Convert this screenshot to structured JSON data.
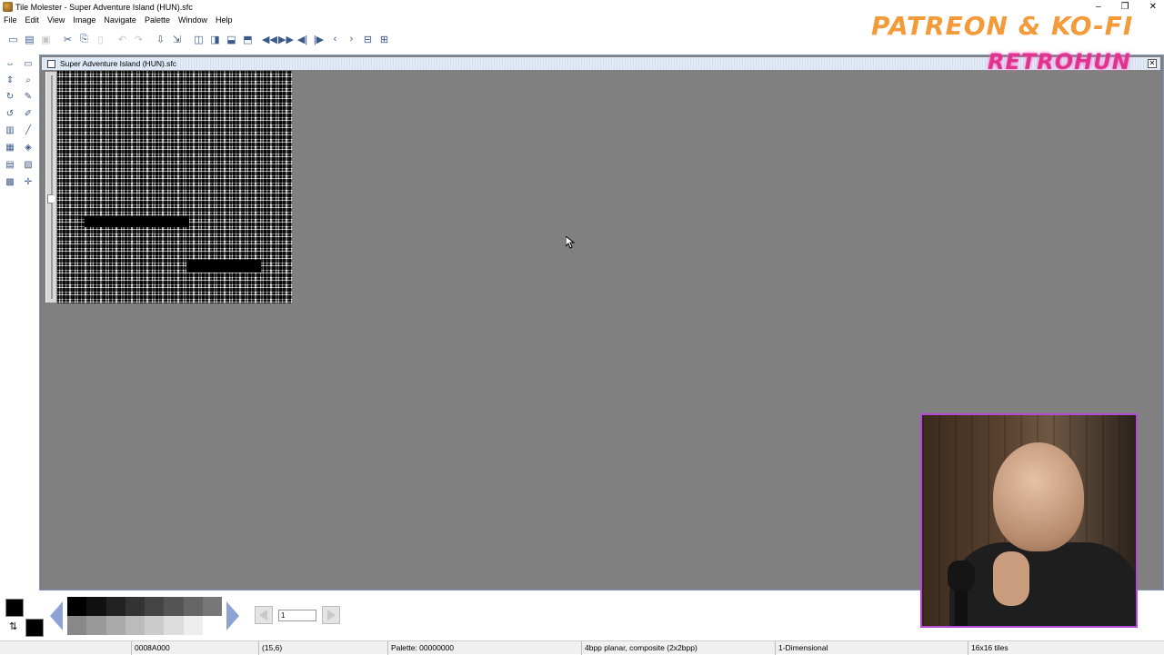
{
  "window": {
    "title": "Tile Molester - Super Adventure Island (HUN).sfc",
    "minimize": "–",
    "maximize": "❐",
    "close": "✕"
  },
  "menu": [
    "File",
    "Edit",
    "View",
    "Image",
    "Navigate",
    "Palette",
    "Window",
    "Help"
  ],
  "toolbar_icons": [
    "new-file-icon",
    "open-file-icon",
    "save-icon",
    "cut-icon",
    "copy-icon",
    "paste-icon",
    "undo-icon",
    "redo-icon",
    "go-to-icon",
    "add-bookmark-icon",
    "decrease-width-icon",
    "increase-width-icon",
    "decrease-height-icon",
    "increase-height-icon",
    "page-back-icon",
    "page-forward-icon",
    "row-back-icon",
    "row-forward-icon",
    "tile-back-icon",
    "tile-forward-icon",
    "byte-back-icon",
    "byte-forward-icon"
  ],
  "tools": [
    "selection-tool-icon",
    "zoom-tool-icon",
    "pencil-tool-icon",
    "brush-tool-icon",
    "line-tool-icon",
    "fill-tool-icon",
    "replace-tool-icon",
    "move-tool-icon",
    "mirror-icon",
    "flip-icon",
    "rotate-right-icon",
    "rotate-left-icon",
    "shift-icon",
    "grid-icon"
  ],
  "document": {
    "frame_title": "Super Adventure Island (HUN).sfc",
    "close": "✕"
  },
  "palette": {
    "colors": [
      "#000000",
      "#111111",
      "#222222",
      "#333333",
      "#444444",
      "#555555",
      "#666666",
      "#777777",
      "#888888",
      "#999999",
      "#aaaaaa",
      "#bbbbbb",
      "#cccccc",
      "#dddddd",
      "#eeeeee",
      "#ffffff"
    ],
    "foreground": "#000000",
    "background": "#000000",
    "page_value": "1"
  },
  "status": {
    "offset": "0008A000",
    "coords": "(15,6)",
    "palette": "Palette: 00000000",
    "codec": "4bpp planar, composite (2x2bpp)",
    "mode": "1-Dimensional",
    "tile_size": "16x16 tiles"
  },
  "overlay": {
    "line1": "PATREON & KO-FI",
    "line2": "RETROHUN"
  }
}
